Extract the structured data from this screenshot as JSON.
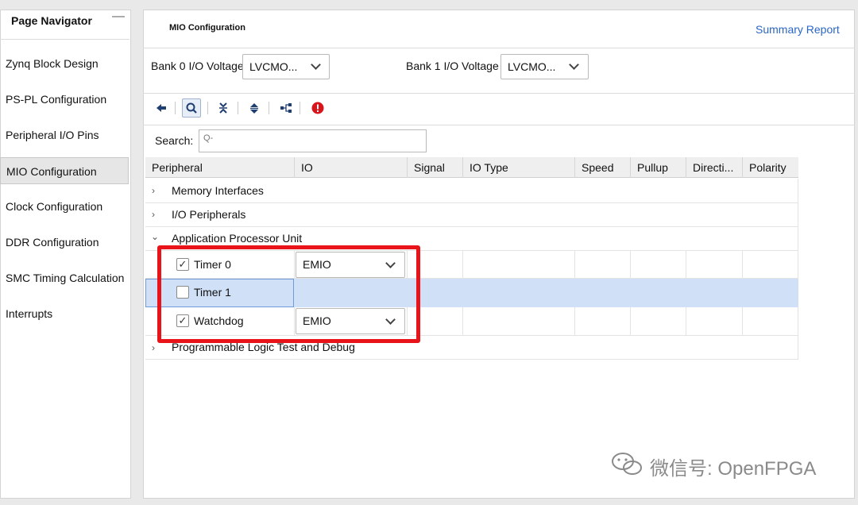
{
  "navigator": {
    "title": "Page Navigator",
    "minimize": "—",
    "items": [
      {
        "label": "Zynq Block Design"
      },
      {
        "label": "PS-PL Configuration"
      },
      {
        "label": "Peripheral I/O Pins"
      },
      {
        "label": "MIO Configuration",
        "selected": true
      },
      {
        "label": "Clock Configuration"
      },
      {
        "label": "DDR Configuration"
      },
      {
        "label": "SMC Timing Calculation"
      },
      {
        "label": "Interrupts"
      }
    ]
  },
  "main": {
    "title": "MIO Configuration",
    "summary_link": "Summary Report",
    "bank0": {
      "label": "Bank 0 I/O Voltage",
      "value": "LVCMO..."
    },
    "bank1": {
      "label": "Bank 1 I/O Voltage",
      "value": "LVCMO..."
    },
    "toolbar": {
      "back_icon": "back-arrow-icon",
      "search_icon": "search-icon",
      "collapse_icon": "collapse-all-icon",
      "expand_icon": "expand-all-icon",
      "hierarchy_icon": "hierarchy-icon",
      "error_icon": "error-icon"
    },
    "search": {
      "label": "Search:",
      "placeholder": "Q-"
    },
    "columns": [
      "Peripheral",
      "IO",
      "Signal",
      "IO Type",
      "Speed",
      "Pullup",
      "Directi...",
      "Polarity"
    ],
    "groups": {
      "memory": "Memory Interfaces",
      "io": "I/O Peripherals",
      "apu": "Application Processor Unit",
      "pl_debug": "Programmable Logic Test and Debug"
    },
    "rows": [
      {
        "name": "Timer 0",
        "checked": true,
        "io": "EMIO"
      },
      {
        "name": "Timer 1",
        "checked": false,
        "io": ""
      },
      {
        "name": "Watchdog",
        "checked": true,
        "io": "EMIO"
      }
    ],
    "check_glyph": "✓"
  },
  "watermark": "微信号: OpenFPGA",
  "colors": {
    "highlight": "#e8141a",
    "selection": "#cfe0f7",
    "link": "#2a66c4"
  }
}
